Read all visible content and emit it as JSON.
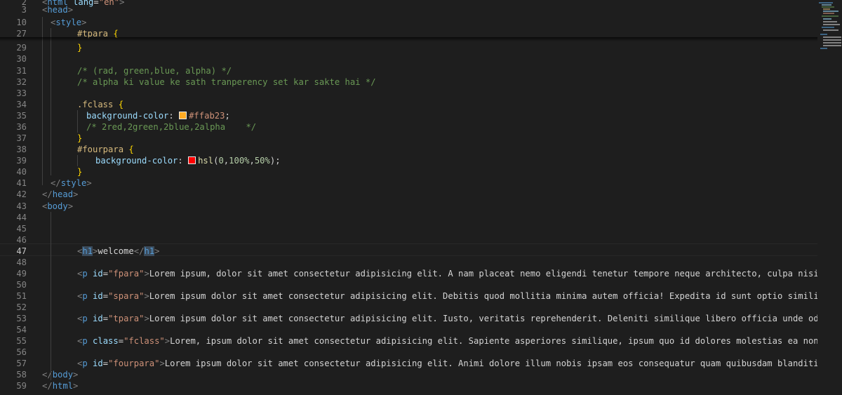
{
  "editor": {
    "lines": [
      {
        "n": "2",
        "segments": [
          {
            "c": "t-br",
            "t": "<"
          },
          {
            "c": "t-tag",
            "t": "html"
          },
          {
            "c": "t-text",
            "t": " "
          },
          {
            "c": "t-attr",
            "t": "lang"
          },
          {
            "c": "t-text",
            "t": "="
          },
          {
            "c": "t-str",
            "t": "\"en\""
          },
          {
            "c": "t-br",
            "t": ">"
          }
        ],
        "indent": 0
      },
      {
        "n": "3",
        "segments": [
          {
            "c": "t-br",
            "t": "<"
          },
          {
            "c": "t-tag",
            "t": "head"
          },
          {
            "c": "t-br",
            "t": ">"
          }
        ],
        "indent": 0
      },
      {
        "n": "10",
        "segments": [
          {
            "c": "t-br",
            "t": "<"
          },
          {
            "c": "t-tag",
            "t": "style"
          },
          {
            "c": "t-br",
            "t": ">"
          }
        ],
        "indent": 1
      },
      {
        "n": "27",
        "segments": [
          {
            "c": "t-sel",
            "t": "#tpara"
          },
          {
            "c": "t-text",
            "t": " "
          },
          {
            "c": "t-brace",
            "t": "{"
          }
        ],
        "indent": 2
      },
      {
        "n": "29",
        "segments": [
          {
            "c": "t-brace",
            "t": "}"
          }
        ],
        "indent": 2
      },
      {
        "n": "30",
        "segments": [],
        "indent": 0
      },
      {
        "n": "31",
        "segments": [
          {
            "c": "t-cmt",
            "t": "/* (rad, green,blue, alpha) */"
          }
        ],
        "indent": 2
      },
      {
        "n": "32",
        "segments": [
          {
            "c": "t-cmt",
            "t": "/* alpha ki value ke sath tranperency set kar sakte hai */"
          }
        ],
        "indent": 2
      },
      {
        "n": "33",
        "segments": [],
        "indent": 0
      },
      {
        "n": "34",
        "segments": [
          {
            "c": "t-sel",
            "t": ".fclass"
          },
          {
            "c": "t-text",
            "t": " "
          },
          {
            "c": "t-brace",
            "t": "{"
          }
        ],
        "indent": 2
      },
      {
        "n": "35",
        "segments": [
          {
            "c": "t-prop",
            "t": "background-color"
          },
          {
            "c": "t-text",
            "t": ": "
          },
          {
            "c": "swatch",
            "t": "#ffab23"
          },
          {
            "c": "t-val",
            "t": "#ffab23"
          },
          {
            "c": "t-text",
            "t": ";"
          }
        ],
        "indent": 2,
        "extra": 13
      },
      {
        "n": "36",
        "segments": [
          {
            "c": "t-cmt",
            "t": "/* 2red,2green,2blue,2alpha    */"
          }
        ],
        "indent": 2,
        "extra": 13
      },
      {
        "n": "37",
        "segments": [
          {
            "c": "t-brace",
            "t": "}"
          }
        ],
        "indent": 2
      },
      {
        "n": "38",
        "segments": [
          {
            "c": "t-sel",
            "t": "#fourpara"
          },
          {
            "c": "t-text",
            "t": " "
          },
          {
            "c": "t-brace",
            "t": "{"
          }
        ],
        "indent": 2
      },
      {
        "n": "39",
        "segments": [
          {
            "c": "t-prop",
            "t": "background-color"
          },
          {
            "c": "t-text",
            "t": ": "
          },
          {
            "c": "swatch",
            "t": "#ff0000"
          },
          {
            "c": "t-fn",
            "t": "hsl"
          },
          {
            "c": "t-text",
            "t": "("
          },
          {
            "c": "t-num",
            "t": "0"
          },
          {
            "c": "t-text",
            "t": ","
          },
          {
            "c": "t-num",
            "t": "100%"
          },
          {
            "c": "t-text",
            "t": ","
          },
          {
            "c": "t-num",
            "t": "50%"
          },
          {
            "c": "t-text",
            "t": ");"
          }
        ],
        "indent": 2,
        "extra": 26
      },
      {
        "n": "40",
        "segments": [
          {
            "c": "t-brace",
            "t": "}"
          }
        ],
        "indent": 2
      },
      {
        "n": "41",
        "segments": [
          {
            "c": "t-br",
            "t": "</"
          },
          {
            "c": "t-tag",
            "t": "style"
          },
          {
            "c": "t-br",
            "t": ">"
          }
        ],
        "indent": 1
      },
      {
        "n": "42",
        "segments": [
          {
            "c": "t-br",
            "t": "</"
          },
          {
            "c": "t-tag",
            "t": "head"
          },
          {
            "c": "t-br",
            "t": ">"
          }
        ],
        "indent": 0
      },
      {
        "n": "43",
        "segments": [
          {
            "c": "t-br",
            "t": "<"
          },
          {
            "c": "t-tag",
            "t": "body"
          },
          {
            "c": "t-br",
            "t": ">"
          }
        ],
        "indent": 0
      },
      {
        "n": "44",
        "segments": [],
        "indent": 0
      },
      {
        "n": "45",
        "segments": [],
        "indent": 0
      },
      {
        "n": "46",
        "segments": [],
        "indent": 0
      },
      {
        "n": "47",
        "segments": [
          {
            "c": "t-br",
            "t": "<"
          },
          {
            "c": "hl-tag",
            "t": "h1"
          },
          {
            "c": "t-br",
            "t": ">"
          },
          {
            "c": "t-text",
            "t": "welcome"
          },
          {
            "c": "t-br",
            "t": "</"
          },
          {
            "c": "hl-tag",
            "t": "h1"
          },
          {
            "c": "t-br",
            "t": ">"
          }
        ],
        "indent": 2,
        "active": true
      },
      {
        "n": "48",
        "segments": [],
        "indent": 0
      },
      {
        "n": "49",
        "segments": [
          {
            "c": "t-br",
            "t": "<"
          },
          {
            "c": "t-tag",
            "t": "p"
          },
          {
            "c": "t-text",
            "t": " "
          },
          {
            "c": "t-attr",
            "t": "id"
          },
          {
            "c": "t-text",
            "t": "="
          },
          {
            "c": "t-str",
            "t": "\"fpara\""
          },
          {
            "c": "t-br",
            "t": ">"
          },
          {
            "c": "t-text",
            "t": "Lorem ipsum, dolor sit amet consectetur adipisicing elit. A nam placeat nemo eligendi tenetur tempore neque architecto, culpa nisi cum saepe expedita ve"
          }
        ],
        "indent": 2
      },
      {
        "n": "50",
        "segments": [],
        "indent": 0
      },
      {
        "n": "51",
        "segments": [
          {
            "c": "t-br",
            "t": "<"
          },
          {
            "c": "t-tag",
            "t": "p"
          },
          {
            "c": "t-text",
            "t": " "
          },
          {
            "c": "t-attr",
            "t": "id"
          },
          {
            "c": "t-text",
            "t": "="
          },
          {
            "c": "t-str",
            "t": "\"spara\""
          },
          {
            "c": "t-br",
            "t": ">"
          },
          {
            "c": "t-text",
            "t": "Lorem ipsum dolor sit amet consectetur adipisicing elit. Debitis quod mollitia minima autem officia! Expedita id sunt optio similique reiciendis impedit"
          }
        ],
        "indent": 2
      },
      {
        "n": "52",
        "segments": [],
        "indent": 0
      },
      {
        "n": "53",
        "segments": [
          {
            "c": "t-br",
            "t": "<"
          },
          {
            "c": "t-tag",
            "t": "p"
          },
          {
            "c": "t-text",
            "t": " "
          },
          {
            "c": "t-attr",
            "t": "id"
          },
          {
            "c": "t-text",
            "t": "="
          },
          {
            "c": "t-str",
            "t": "\"tpara\""
          },
          {
            "c": "t-br",
            "t": ">"
          },
          {
            "c": "t-text",
            "t": "Lorem ipsum dolor sit amet consectetur adipisicing elit. Iusto, veritatis reprehenderit. Deleniti similique libero officia unde odio dolor fugiat porro,"
          }
        ],
        "indent": 2
      },
      {
        "n": "54",
        "segments": [],
        "indent": 0
      },
      {
        "n": "55",
        "segments": [
          {
            "c": "t-br",
            "t": "<"
          },
          {
            "c": "t-tag",
            "t": "p"
          },
          {
            "c": "t-text",
            "t": " "
          },
          {
            "c": "t-attr",
            "t": "class"
          },
          {
            "c": "t-text",
            "t": "="
          },
          {
            "c": "t-str",
            "t": "\"fclass\""
          },
          {
            "c": "t-br",
            "t": ">"
          },
          {
            "c": "t-text",
            "t": "Lorem, ipsum dolor sit amet consectetur adipisicing elit. Sapiente asperiores similique, ipsum quo id dolores molestias ea non obcaecati dolorem rep"
          }
        ],
        "indent": 2
      },
      {
        "n": "56",
        "segments": [],
        "indent": 0
      },
      {
        "n": "57",
        "segments": [
          {
            "c": "t-br",
            "t": "<"
          },
          {
            "c": "t-tag",
            "t": "p"
          },
          {
            "c": "t-text",
            "t": " "
          },
          {
            "c": "t-attr",
            "t": "id"
          },
          {
            "c": "t-text",
            "t": "="
          },
          {
            "c": "t-str",
            "t": "\"fourpara\""
          },
          {
            "c": "t-br",
            "t": ">"
          },
          {
            "c": "t-text",
            "t": "Lorem ipsum dolor sit amet consectetur adipisicing elit. Animi dolore illum nobis ipsam eos consequatur quam quibusdam blanditiis vero obcaecati aper"
          }
        ],
        "indent": 2
      },
      {
        "n": "58",
        "segments": [
          {
            "c": "t-br",
            "t": "</"
          },
          {
            "c": "t-tag",
            "t": "body"
          },
          {
            "c": "t-br",
            "t": ">"
          }
        ],
        "indent": 0
      },
      {
        "n": "59",
        "segments": [
          {
            "c": "t-br",
            "t": "</"
          },
          {
            "c": "t-tag",
            "t": "html"
          },
          {
            "c": "t-br",
            "t": ">"
          }
        ],
        "indent": 0
      }
    ]
  },
  "colors": {
    "background": "#1e1e1e",
    "swatch_orange": "#ffab23",
    "swatch_red": "#ff0000"
  }
}
